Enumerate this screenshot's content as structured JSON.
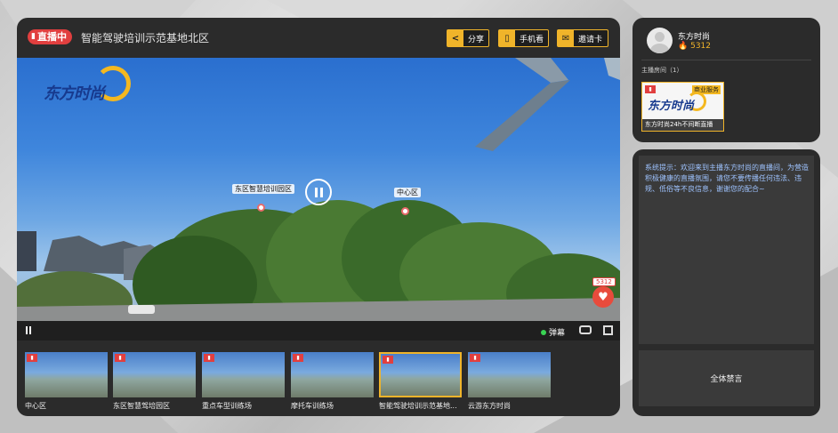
{
  "header": {
    "live_badge": "直播中",
    "room_title": "智能驾驶培训示范基地北区",
    "share_label": "分享",
    "mobile_label": "手机看",
    "invite_label": "邀请卡"
  },
  "video": {
    "logo_text": "东方时尚",
    "hotspots": [
      {
        "label": "东区智慧培训园区"
      },
      {
        "label": "中心区"
      }
    ],
    "like_count": "5312",
    "danmu_label": "弹幕"
  },
  "thumbnails": [
    {
      "caption": "中心区",
      "active": false
    },
    {
      "caption": "东区智慧驾培园区",
      "active": false
    },
    {
      "caption": "重点车型训练场",
      "active": false
    },
    {
      "caption": "摩托车训练场",
      "active": false
    },
    {
      "caption": "智能驾驶培训示范基地...",
      "active": true
    },
    {
      "caption": "云游东方时尚",
      "active": false
    }
  ],
  "host": {
    "name": "东方时尚",
    "hot_value": "5312",
    "rooms_label": "主播房间（1）",
    "room_card": {
      "badge": "商业服务",
      "logo_text": "东方时尚",
      "title": "东方时尚24h不间断直播"
    }
  },
  "chat": {
    "system_message": "系统提示：欢迎来到主播东方时尚的直播间，为营造积极健康的直播氛围，请您不要传播任何违法、违规、低俗等不良信息，谢谢您的配合~",
    "mute_all_label": "全体禁言"
  },
  "colors": {
    "accent": "#f0b42a",
    "live_red": "#e13f3f",
    "panel_bg": "#2b2b2b"
  }
}
